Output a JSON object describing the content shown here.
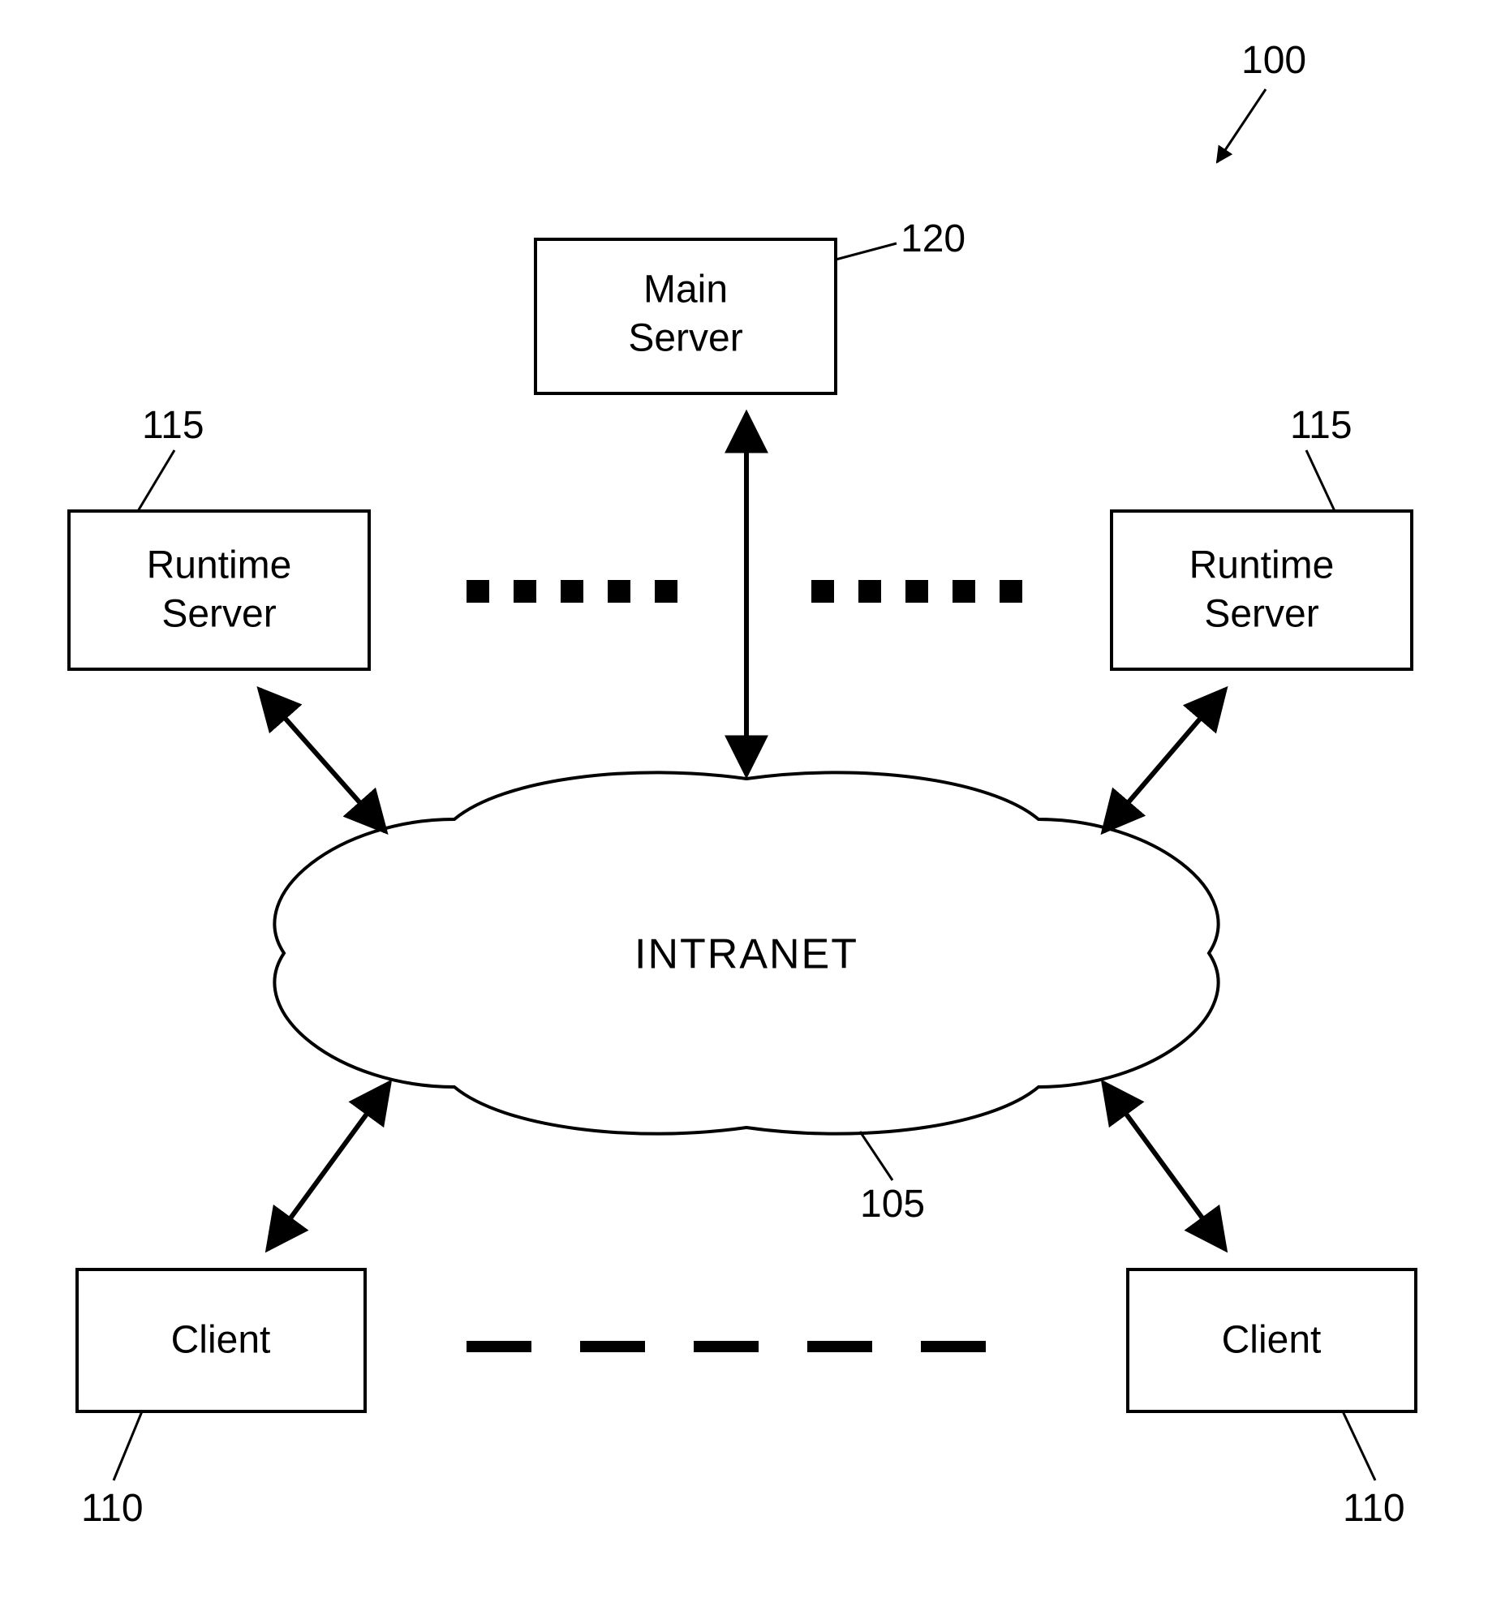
{
  "diagram": {
    "ref_system": "100",
    "main_server": {
      "label1": "Main",
      "label2": "Server",
      "ref": "120"
    },
    "runtime_left": {
      "label1": "Runtime",
      "label2": "Server",
      "ref": "115"
    },
    "runtime_right": {
      "label1": "Runtime",
      "label2": "Server",
      "ref": "115"
    },
    "cloud": {
      "label": "INTRANET",
      "ref": "105"
    },
    "client_left": {
      "label": "Client",
      "ref": "110"
    },
    "client_right": {
      "label": "Client",
      "ref": "110"
    }
  }
}
